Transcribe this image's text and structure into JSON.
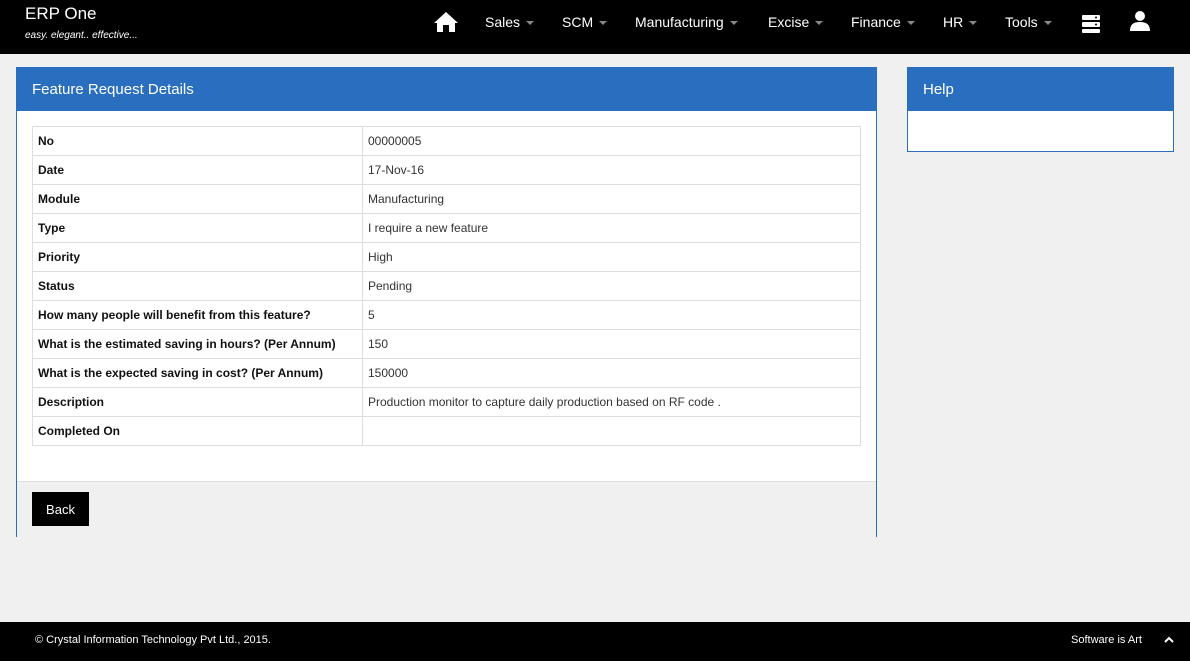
{
  "brand": {
    "title": "ERP One",
    "tagline": "easy. elegant.. effective..."
  },
  "nav": {
    "items": [
      "Sales",
      "SCM",
      "Manufacturing",
      "Excise",
      "Finance",
      "HR",
      "Tools"
    ]
  },
  "panel": {
    "title": "Feature Request Details"
  },
  "details": [
    {
      "label": "No",
      "value": "00000005"
    },
    {
      "label": "Date",
      "value": "17-Nov-16"
    },
    {
      "label": "Module",
      "value": "Manufacturing"
    },
    {
      "label": "Type",
      "value": "I require a new feature"
    },
    {
      "label": "Priority",
      "value": "High"
    },
    {
      "label": "Status",
      "value": "Pending"
    },
    {
      "label": "How many people will benefit from this feature?",
      "value": "5"
    },
    {
      "label": "What is the estimated saving in hours? (Per Annum)",
      "value": "150"
    },
    {
      "label": "What is the expected saving in cost? (Per Annum)",
      "value": "150000"
    },
    {
      "label": "Description",
      "value": "Production monitor to capture daily production based on RF code ."
    },
    {
      "label": "Completed On",
      "value": ""
    }
  ],
  "actions": {
    "back_label": "Back"
  },
  "help": {
    "title": "Help"
  },
  "footer": {
    "copyright": "© Crystal Information Technology Pvt Ltd., 2015.",
    "slogan": "Software is Art"
  },
  "colors": {
    "accent": "#2a6fbf",
    "navbar": "#000000"
  }
}
